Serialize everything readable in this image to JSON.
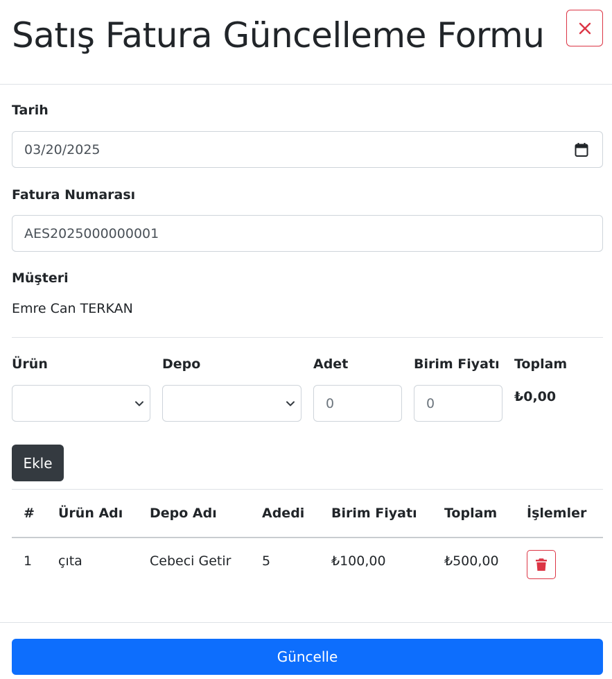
{
  "modal": {
    "title": "Satış Fatura Güncelleme Formu",
    "close_icon": "close-icon"
  },
  "form": {
    "date_label": "Tarih",
    "date_value": "03/20/2025",
    "invoice_label": "Fatura Numarası",
    "invoice_value": "AES2025000000001",
    "customer_label": "Müşteri",
    "customer_value": "Emre Can TERKAN"
  },
  "item_entry": {
    "product_label": "Ürün",
    "product_value": "",
    "warehouse_label": "Depo",
    "warehouse_value": "",
    "quantity_label": "Adet",
    "quantity_value": "0",
    "unit_price_label": "Birim Fiyatı",
    "unit_price_value": "0",
    "total_label": "Toplam",
    "total_value": "₺0,00",
    "add_label": "Ekle"
  },
  "table": {
    "headers": [
      "#",
      "Ürün Adı",
      "Depo Adı",
      "Adedi",
      "Birim Fiyatı",
      "Toplam",
      "İşlemler"
    ],
    "rows": [
      {
        "index": "1",
        "product": "çıta",
        "warehouse": "Cebeci Getir",
        "quantity": "5",
        "unit_price": "₺100,00",
        "total": "₺500,00",
        "action_icon": "trash-icon"
      }
    ]
  },
  "footer": {
    "submit_label": "Güncelle"
  },
  "colors": {
    "primary": "#0d6efd",
    "danger": "#dc3545",
    "dark": "#343a40",
    "border": "#ced4da"
  }
}
